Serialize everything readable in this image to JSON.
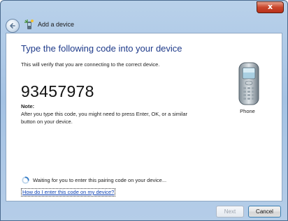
{
  "window": {
    "title": "Add a device",
    "close_label": "x"
  },
  "main": {
    "heading": "Type the following code into your device",
    "subtext": "This will verify that you are connecting to the correct device.",
    "code": "93457978",
    "note_label": "Note:",
    "note_text": "After you type this code, you might need to press Enter, OK, or a similar button on your device.",
    "device_label": "Phone",
    "waiting_text": "Waiting for you to enter this pairing code on your device...",
    "help_link": "How do I enter this code on my device?"
  },
  "footer": {
    "next_label": "Next",
    "cancel_label": "Cancel"
  },
  "colors": {
    "heading": "#1e3a8a",
    "link": "#0a3fb3",
    "close": "#c9462c"
  }
}
